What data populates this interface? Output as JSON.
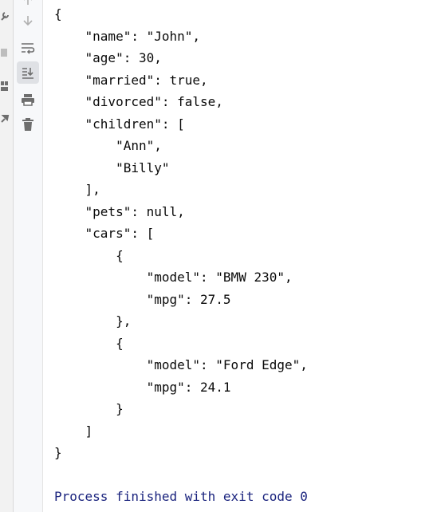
{
  "toolbar": {
    "icons": [
      "arrow-up-icon",
      "arrow-down-icon",
      "soft-wrap-icon",
      "scroll-to-end-icon",
      "print-icon",
      "trash-icon"
    ],
    "active": "scroll-to-end-icon",
    "accent": "#6e6e6e"
  },
  "console": {
    "lines": [
      "{",
      "    \"name\": \"John\",",
      "    \"age\": 30,",
      "    \"married\": true,",
      "    \"divorced\": false,",
      "    \"children\": [",
      "        \"Ann\",",
      "        \"Billy\"",
      "    ],",
      "    \"pets\": null,",
      "    \"cars\": [",
      "        {",
      "            \"model\": \"BMW 230\",",
      "            \"mpg\": 27.5",
      "        },",
      "        {",
      "            \"model\": \"Ford Edge\",",
      "            \"mpg\": 24.1",
      "        }",
      "    ]",
      "}"
    ],
    "process_message": "Process finished with exit code 0",
    "process_color": "#1a237e"
  }
}
